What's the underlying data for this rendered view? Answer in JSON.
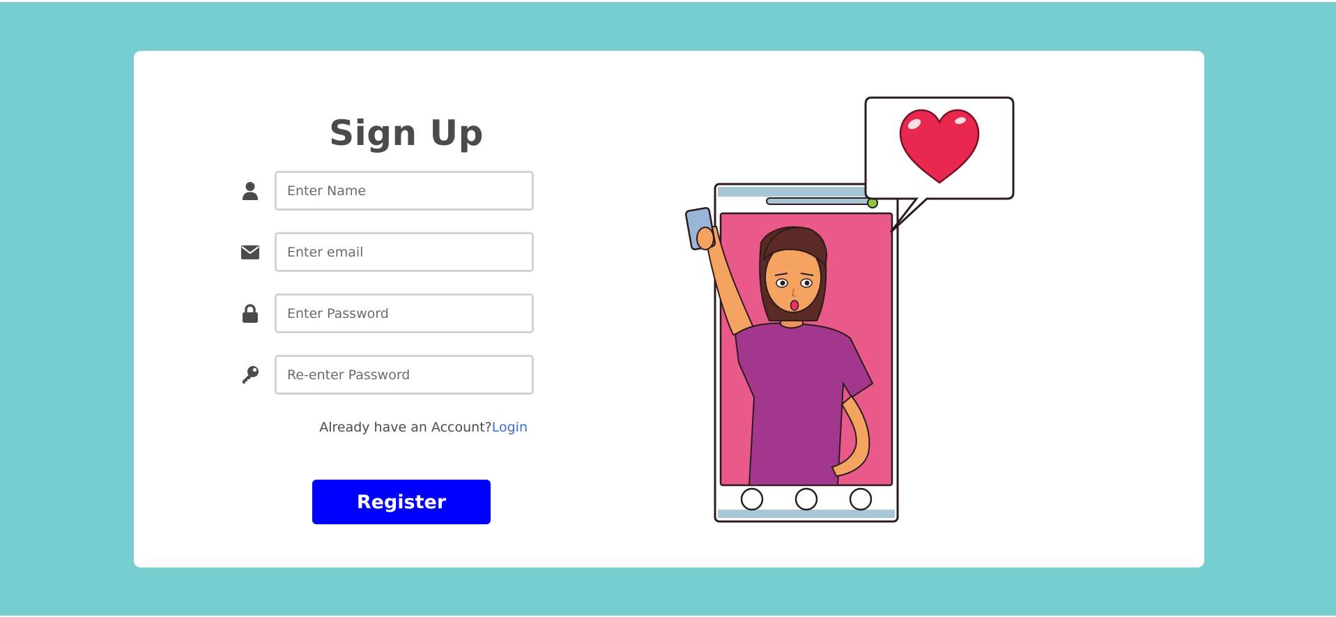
{
  "signup": {
    "title": "Sign Up",
    "fields": [
      {
        "placeholder": "Enter Name",
        "icon": "user-icon",
        "type": "text"
      },
      {
        "placeholder": "Enter email",
        "icon": "envelope-icon",
        "type": "email"
      },
      {
        "placeholder": "Enter Password",
        "icon": "lock-icon",
        "type": "password"
      },
      {
        "placeholder": "Re-enter Password",
        "icon": "key-icon",
        "type": "password"
      }
    ],
    "account_prompt": "Already have an Account?",
    "login_label": "Login",
    "register_label": "Register"
  },
  "colors": {
    "page_background": "#76cfce",
    "card_background": "#ffffff",
    "register_button": "#0000ff",
    "login_link": "#3a6fd6",
    "heading": "#4b4b4b"
  },
  "illustration": {
    "subject": "woman-taking-selfie-in-phone",
    "bubble_icon": "heart-icon"
  }
}
